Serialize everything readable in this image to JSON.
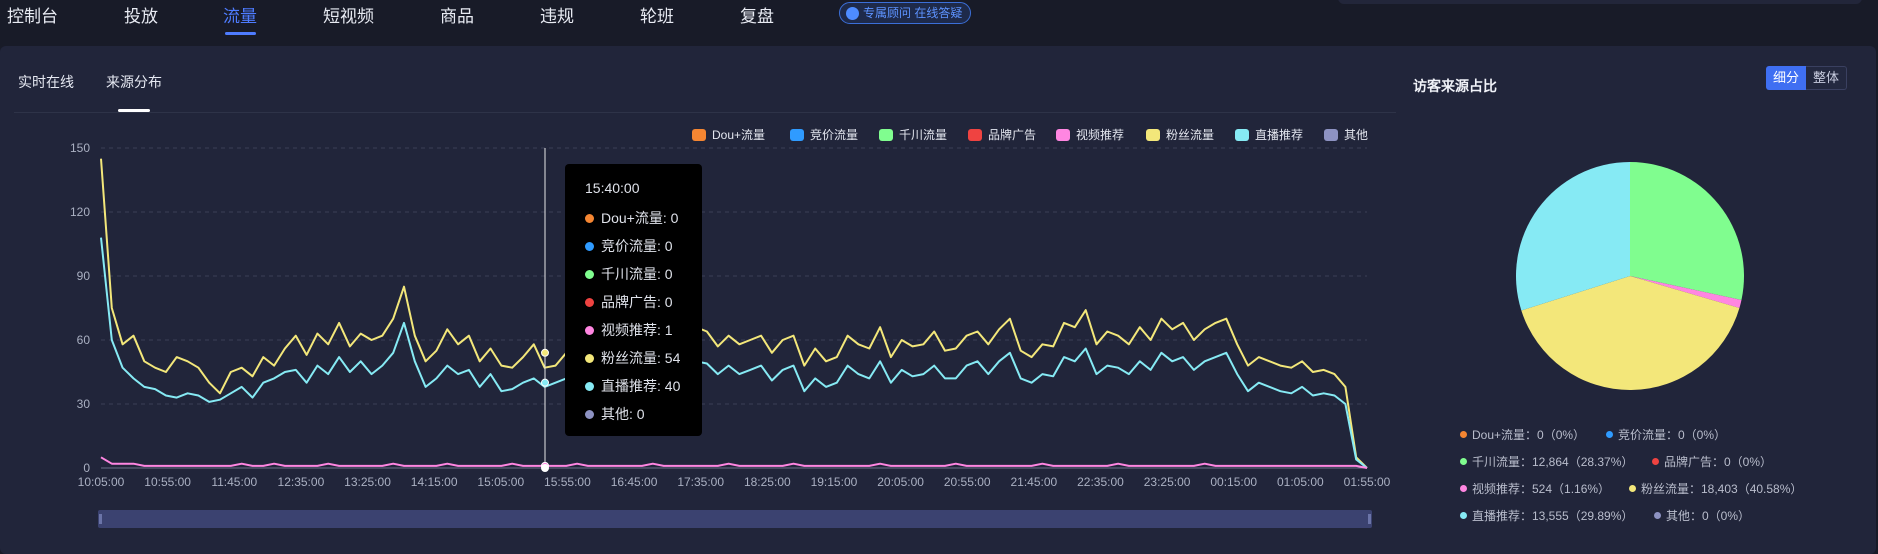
{
  "nav": {
    "items": [
      {
        "label": "控制台"
      },
      {
        "label": "投放"
      },
      {
        "label": "流量",
        "active": true
      },
      {
        "label": "短视频"
      },
      {
        "label": "商品"
      },
      {
        "label": "违规"
      },
      {
        "label": "轮班"
      },
      {
        "label": "复盘"
      }
    ],
    "consult_label": "专属顾问 在线答疑"
  },
  "tabs": {
    "realtime": "实时在线",
    "source": "来源分布",
    "active": "来源分布"
  },
  "colors": {
    "accent": "#4e7cff",
    "dou": "#f58632",
    "bid": "#2f9bff",
    "qianchuan": "#80fd8f",
    "brand": "#ef4341",
    "video": "#ff86e1",
    "fans": "#f3e77a",
    "live": "#86eaf4",
    "other": "#8d92c2"
  },
  "legend": [
    {
      "name": "Dou+流量",
      "color": "#f58632"
    },
    {
      "name": "竞价流量",
      "color": "#2f9bff"
    },
    {
      "name": "千川流量",
      "color": "#80fd8f"
    },
    {
      "name": "品牌广告",
      "color": "#ef4341"
    },
    {
      "name": "视频推荐",
      "color": "#ff86e1"
    },
    {
      "name": "粉丝流量",
      "color": "#f3e77a"
    },
    {
      "name": "直播推荐",
      "color": "#86eaf4"
    },
    {
      "name": "其他",
      "color": "#8d92c2"
    }
  ],
  "chart_data": [
    {
      "type": "line",
      "y_ticks": [
        0,
        30,
        60,
        90,
        120,
        150
      ],
      "ylim": [
        0,
        150
      ],
      "x_ticks": [
        "10:05:00",
        "10:55:00",
        "11:45:00",
        "12:35:00",
        "13:25:00",
        "14:15:00",
        "15:05:00",
        "15:55:00",
        "16:45:00",
        "17:35:00",
        "18:25:00",
        "19:15:00",
        "20:05:00",
        "20:55:00",
        "21:45:00",
        "22:35:00",
        "23:25:00",
        "00:15:00",
        "01:05:00",
        "01:55:00"
      ],
      "x_range": [
        "10:05:00",
        "01:55:00"
      ],
      "grid": true,
      "legend_position": "top-right",
      "series": [
        {
          "name": "粉丝流量",
          "color": "#f3e77a",
          "values": [
            145,
            75,
            58,
            62,
            50,
            47,
            45,
            52,
            50,
            47,
            40,
            35,
            45,
            47,
            43,
            52,
            48,
            56,
            62,
            53,
            63,
            58,
            68,
            57,
            63,
            60,
            62,
            70,
            85,
            62,
            50,
            55,
            65,
            58,
            62,
            50,
            56,
            48,
            47,
            52,
            58,
            47,
            48,
            54,
            56,
            60,
            54,
            62,
            58,
            65,
            50,
            62,
            58,
            55,
            62,
            66,
            64,
            57,
            62,
            58,
            60,
            62,
            54,
            60,
            62,
            48,
            56,
            50,
            52,
            62,
            58,
            56,
            66,
            52,
            60,
            57,
            58,
            64,
            55,
            56,
            62,
            64,
            58,
            65,
            70,
            55,
            52,
            58,
            57,
            68,
            66,
            74,
            58,
            64,
            62,
            58,
            66,
            60,
            70,
            65,
            68,
            60,
            65,
            68,
            70,
            58,
            48,
            52,
            50,
            48,
            47,
            50,
            45,
            46,
            44,
            38,
            5,
            0
          ]
        },
        {
          "name": "直播推荐",
          "color": "#86eaf4",
          "values": [
            108,
            60,
            47,
            42,
            38,
            37,
            34,
            33,
            35,
            34,
            31,
            32,
            35,
            38,
            33,
            40,
            42,
            45,
            46,
            40,
            48,
            44,
            52,
            45,
            50,
            44,
            48,
            54,
            68,
            50,
            38,
            42,
            48,
            44,
            46,
            38,
            44,
            36,
            37,
            40,
            42,
            38,
            40,
            42,
            44,
            46,
            42,
            48,
            44,
            50,
            38,
            48,
            44,
            42,
            48,
            50,
            49,
            44,
            48,
            44,
            46,
            48,
            41,
            46,
            48,
            36,
            42,
            38,
            40,
            48,
            44,
            42,
            50,
            40,
            46,
            43,
            44,
            48,
            42,
            42,
            48,
            50,
            44,
            50,
            54,
            42,
            40,
            44,
            43,
            52,
            50,
            56,
            44,
            48,
            47,
            44,
            50,
            46,
            54,
            50,
            52,
            46,
            50,
            52,
            54,
            44,
            36,
            40,
            38,
            36,
            35,
            38,
            34,
            35,
            34,
            30,
            4,
            0
          ]
        },
        {
          "name": "视频推荐",
          "color": "#ff86e1",
          "values": [
            5,
            2,
            2,
            2,
            1,
            1,
            1,
            1,
            1,
            1,
            1,
            1,
            1,
            2,
            1,
            1,
            2,
            1,
            1,
            1,
            1,
            2,
            1,
            1,
            1,
            1,
            1,
            2,
            1,
            1,
            1,
            1,
            2,
            1,
            1,
            1,
            1,
            1,
            2,
            1,
            1,
            1,
            1,
            1,
            2,
            1,
            1,
            1,
            1,
            1,
            1,
            2,
            1,
            1,
            1,
            1,
            1,
            1,
            2,
            1,
            1,
            1,
            1,
            1,
            2,
            1,
            1,
            1,
            1,
            1,
            1,
            1,
            2,
            1,
            1,
            1,
            1,
            1,
            1,
            2,
            1,
            1,
            1,
            1,
            1,
            1,
            1,
            2,
            1,
            1,
            1,
            1,
            1,
            1,
            2,
            1,
            1,
            1,
            1,
            1,
            1,
            1,
            2,
            1,
            1,
            1,
            1,
            1,
            1,
            1,
            1,
            1,
            1,
            1,
            1,
            1,
            1,
            0
          ]
        }
      ]
    },
    {
      "type": "pie",
      "title": "访客来源占比",
      "slices": [
        {
          "name": "Dou+流量",
          "value": 0,
          "percent": 0,
          "label": "Dou+流量：0（0%）",
          "color": "#f58632"
        },
        {
          "name": "竞价流量",
          "value": 0,
          "percent": 0,
          "label": "竞价流量：0（0%）",
          "color": "#2f9bff"
        },
        {
          "name": "千川流量",
          "value": 12864,
          "percent": 28.37,
          "label": "千川流量：12,864（28.37%）",
          "color": "#80fd8f"
        },
        {
          "name": "品牌广告",
          "value": 0,
          "percent": 0,
          "label": "品牌广告：0（0%）",
          "color": "#ef4341"
        },
        {
          "name": "视频推荐",
          "value": 524,
          "percent": 1.16,
          "label": "视频推荐：524（1.16%）",
          "color": "#ff86e1"
        },
        {
          "name": "粉丝流量",
          "value": 18403,
          "percent": 40.58,
          "label": "粉丝流量：18,403（40.58%）",
          "color": "#f3e77a"
        },
        {
          "name": "直播推荐",
          "value": 13555,
          "percent": 29.89,
          "label": "直播推荐：13,555（29.89%）",
          "color": "#86eaf4"
        },
        {
          "name": "其他",
          "value": 0,
          "percent": 0,
          "label": "其他：0（0%）",
          "color": "#8d92c2"
        }
      ]
    }
  ],
  "tooltip": {
    "time": "15:40:00",
    "rows": [
      {
        "label": "Dou+流量: 0",
        "color": "#f58632"
      },
      {
        "label": "竞价流量: 0",
        "color": "#2f9bff"
      },
      {
        "label": "千川流量: 0",
        "color": "#80fd8f"
      },
      {
        "label": "品牌广告: 0",
        "color": "#ef4341"
      },
      {
        "label": "视频推荐: 1",
        "color": "#ff86e1"
      },
      {
        "label": "粉丝流量: 54",
        "color": "#f3e77a"
      },
      {
        "label": "直播推荐: 40",
        "color": "#86eaf4"
      },
      {
        "label": "其他: 0",
        "color": "#8d92c2"
      }
    ]
  },
  "pie_toggle": {
    "detail": "细分",
    "overall": "整体",
    "active": "细分"
  }
}
